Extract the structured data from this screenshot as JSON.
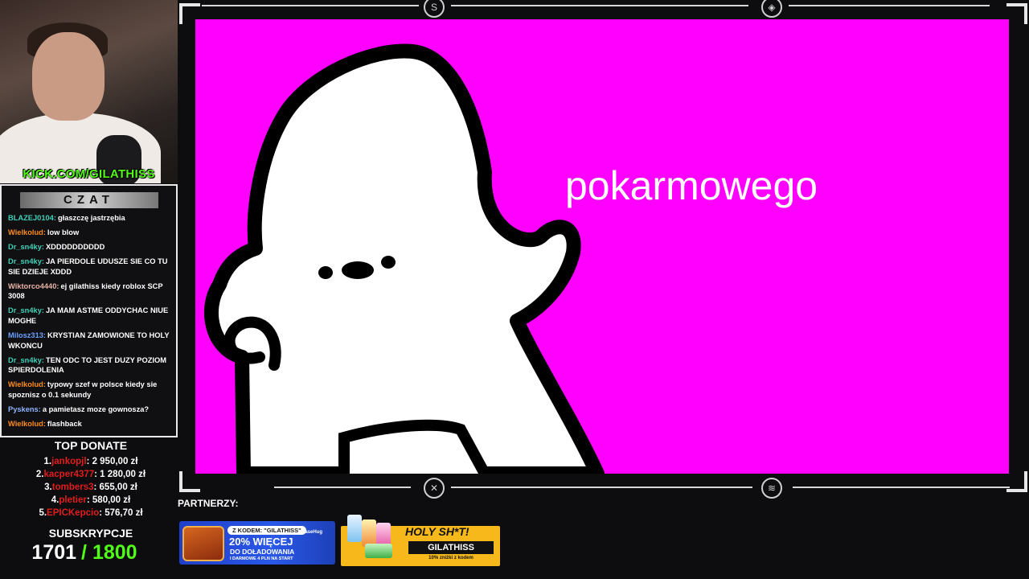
{
  "overlay": {
    "kick_url": "KICK.COM/GILATHISS",
    "chat_title": "CZAT",
    "chat": [
      {
        "user": "BLAZEJ0104:",
        "color": "#41d0b7",
        "text": "głaszczę jastrzębia"
      },
      {
        "user": "Wielkolud:",
        "color": "#ff8c1a",
        "text": "low blow"
      },
      {
        "user": "Dr_sn4ky:",
        "color": "#41d0b7",
        "text": "XDDDDDDDDDD"
      },
      {
        "user": "Dr_sn4ky:",
        "color": "#41d0b7",
        "text": "JA PIERDOLE UDUSZE SIE CO TU SIE DZIEJE XDDD"
      },
      {
        "user": "Wiktorco4440:",
        "color": "#e8b3a6",
        "text": "ej gilathiss kiedy roblox SCP 3008"
      },
      {
        "user": "Dr_sn4ky:",
        "color": "#41d0b7",
        "text": "JA MAM ASTME ODDYCHAC NIUE MOGHE"
      },
      {
        "user": "Milosz313:",
        "color": "#6aa0ff",
        "text": "KRYSTIAN ZAMOWIONE TO HOLY WKONCU"
      },
      {
        "user": "Dr_sn4ky:",
        "color": "#41d0b7",
        "text": "TEN ODC TO JEST DUZY POZIOM SPIERDOLENIA"
      },
      {
        "user": "Wielkolud:",
        "color": "#ff8c1a",
        "text": "typowy szef w polsce kiedy sie spoznisz o 0.1 sekundy"
      },
      {
        "user": "Pyskens:",
        "color": "#8fb3ff",
        "text": "a pamietasz moze gownosza?"
      },
      {
        "user": "Wielkolud:",
        "color": "#ff8c1a",
        "text": "flashback"
      }
    ],
    "top_donate_title": "TOP DONATE",
    "donations": [
      {
        "rank": "1.",
        "name": "jankopjl",
        "amount": ": 2 950,00 zł"
      },
      {
        "rank": "2.",
        "name": "kacper4377",
        "amount": ": 1 280,00 zł"
      },
      {
        "rank": "3.",
        "name": "tombers3",
        "amount": ": 655,00 zł"
      },
      {
        "rank": "4.",
        "name": "pletier",
        "amount": ": 580,00 zł"
      },
      {
        "rank": "5.",
        "name": "EPICKepcio",
        "amount": ": 576,70 zł"
      }
    ],
    "subs_title": "SUBSKRYPCJE",
    "subs_current": "1701",
    "subs_goal": "/ 1800",
    "video_caption": "pokarmowego",
    "partners_label": "PARTNERZY:",
    "banner_casehug": {
      "code": "Z KODEM: \"GILATHISS\"",
      "brand": "CaseHug",
      "main": "20% WIĘCEJ",
      "sub": "DO DOŁADOWANIA",
      "fine": "I DARMOWE 4 PLN NA START"
    },
    "banner_holy": {
      "title": "HOLY SH*T!",
      "code": "GILATHISS",
      "fine": "10% zniżki z kodem"
    }
  },
  "colors": {
    "video_bg": "#ff00ff",
    "kick_green": "#53fc18",
    "donor_red": "#e11d1d"
  }
}
